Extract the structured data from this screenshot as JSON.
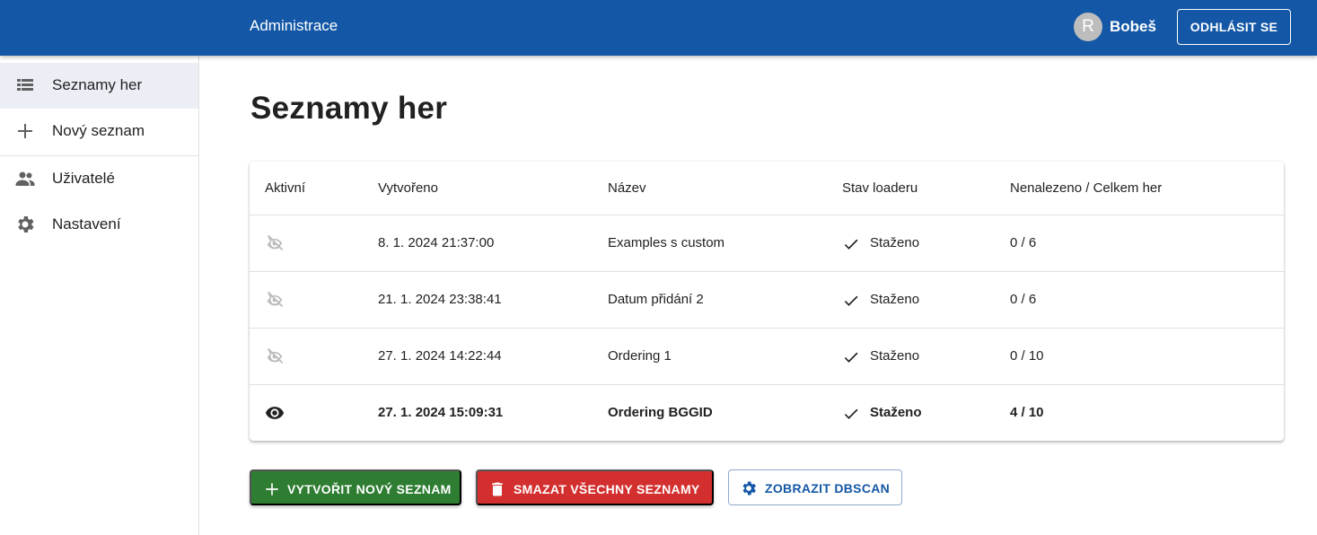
{
  "appbar": {
    "title": "Administrace",
    "avatar_letter": "R",
    "username": "Bobeš",
    "logout_label": "ODHLÁSIT SE"
  },
  "sidebar": {
    "items": [
      {
        "label": "Seznamy her",
        "icon": "list-icon",
        "selected": true
      },
      {
        "label": "Nový seznam",
        "icon": "plus-icon"
      },
      {
        "label": "Uživatelé",
        "icon": "people-icon"
      },
      {
        "label": "Nastavení",
        "icon": "gear-icon"
      }
    ]
  },
  "main": {
    "title": "Seznamy her",
    "table": {
      "headers": [
        "Aktivní",
        "Vytvořeno",
        "Název",
        "Stav loaderu",
        "Nenalezeno / Celkem her"
      ],
      "rows": [
        {
          "active": false,
          "created": "8. 1. 2024 21:37:00",
          "name": "Examples s custom",
          "status": "Staženo",
          "counts": "0 / 6"
        },
        {
          "active": false,
          "created": "21. 1. 2024 23:38:41",
          "name": "Datum přidání 2",
          "status": "Staženo",
          "counts": "0 / 6"
        },
        {
          "active": false,
          "created": "27. 1. 2024 14:22:44",
          "name": "Ordering 1",
          "status": "Staženo",
          "counts": "0 / 10"
        },
        {
          "active": true,
          "created": "27. 1. 2024 15:09:31",
          "name": "Ordering BGGID",
          "status": "Staženo",
          "counts": "4 / 10"
        }
      ]
    },
    "buttons": {
      "create": "VYTVOŘIT NOVÝ SEZNAM",
      "delete": "SMAZAT VŠECHNY SEZNAMY",
      "dbscan": "ZOBRAZIT DBSCAN"
    }
  },
  "colors": {
    "appbar": "#1357a6",
    "create": "#2e7d32",
    "delete": "#d32f2f",
    "selected_nav": "#ebeff5"
  }
}
